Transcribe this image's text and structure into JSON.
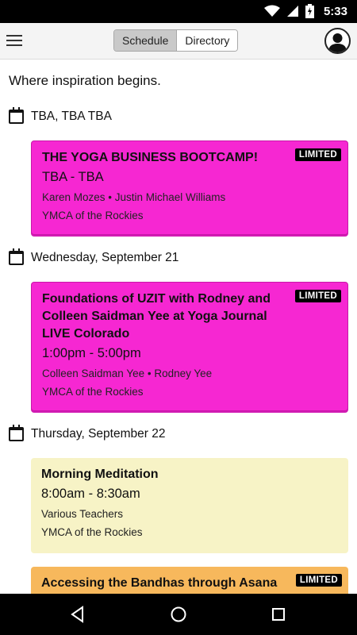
{
  "status_bar": {
    "time": "5:33",
    "icons": [
      "wifi-icon",
      "cellular-icon",
      "battery-charging-icon"
    ]
  },
  "header": {
    "tabs": [
      {
        "label": "Schedule",
        "active": true
      },
      {
        "label": "Directory",
        "active": false
      }
    ]
  },
  "tagline": "Where inspiration begins.",
  "days": [
    {
      "label": "TBA, TBA TBA",
      "sessions": [
        {
          "title": "THE YOGA BUSINESS BOOTCAMP!",
          "time": "TBA - TBA",
          "teachers": "Karen Mozes • Justin Michael Williams",
          "location": "YMCA of the Rockies",
          "badge": "LIMITED",
          "color": "#f627d2"
        }
      ]
    },
    {
      "label": "Wednesday, September 21",
      "sessions": [
        {
          "title": "Foundations of UZIT with Rodney and Colleen Saidman Yee at Yoga Journal LIVE Colorado",
          "time": "1:00pm - 5:00pm",
          "teachers": "Colleen Saidman Yee • Rodney Yee",
          "location": "YMCA of the Rockies",
          "badge": "LIMITED",
          "color": "#f627d2"
        }
      ]
    },
    {
      "label": "Thursday, September 22",
      "sessions": [
        {
          "title": "Morning Meditation",
          "time": "8:00am - 8:30am",
          "teachers": "Various Teachers",
          "location": "YMCA of the Rockies",
          "badge": "",
          "color": "#f7f3c6"
        },
        {
          "title": "Accessing the Bandhas through Asana",
          "badge": "LIMITED",
          "color": "#f7b85c"
        }
      ]
    }
  ],
  "nav": [
    "back-icon",
    "home-icon",
    "recents-icon"
  ]
}
